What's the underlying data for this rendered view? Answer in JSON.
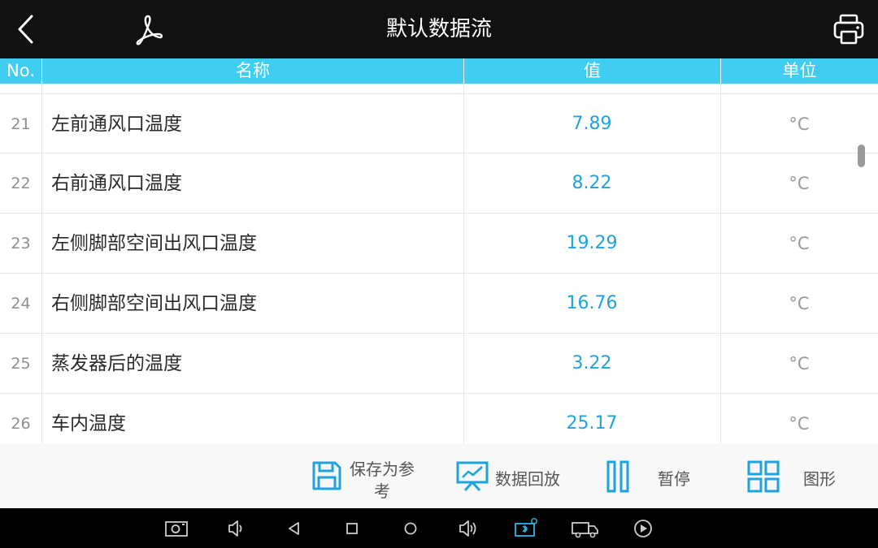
{
  "header": {
    "title": "默认数据流"
  },
  "columns": {
    "no": "No.",
    "name": "名称",
    "value": "值",
    "unit": "单位"
  },
  "rows": [
    {
      "no": "21",
      "name": "左前通风口温度",
      "value": "7.89",
      "unit": "°C"
    },
    {
      "no": "22",
      "name": "右前通风口温度",
      "value": "8.22",
      "unit": "°C"
    },
    {
      "no": "23",
      "name": "左侧脚部空间出风口温度",
      "value": "19.29",
      "unit": "°C"
    },
    {
      "no": "24",
      "name": "右侧脚部空间出风口温度",
      "value": "16.76",
      "unit": "°C"
    },
    {
      "no": "25",
      "name": "蒸发器后的温度",
      "value": "3.22",
      "unit": "°C"
    },
    {
      "no": "26",
      "name": "车内温度",
      "value": "25.17",
      "unit": "°C"
    }
  ],
  "actions": {
    "save_reference_line1": "保存为参",
    "save_reference_line2": "考",
    "playback": "数据回放",
    "pause": "暂停",
    "graph": "图形"
  },
  "colors": {
    "accent": "#3fcdf1",
    "value_text": "#1ea3dc",
    "topbar": "#111111",
    "icon": "#1ea3dc"
  },
  "icons": {
    "topbar": [
      "back-icon",
      "pdf-icon",
      "print-icon"
    ],
    "actions": [
      "save-icon",
      "playback-icon",
      "pause-icon",
      "grid-icon"
    ],
    "system": [
      "screenshot-icon",
      "volume-down-icon",
      "nav-back-icon",
      "nav-recent-icon",
      "nav-home-icon",
      "volume-up-icon",
      "vci-icon",
      "truck-icon",
      "play-icon"
    ]
  }
}
